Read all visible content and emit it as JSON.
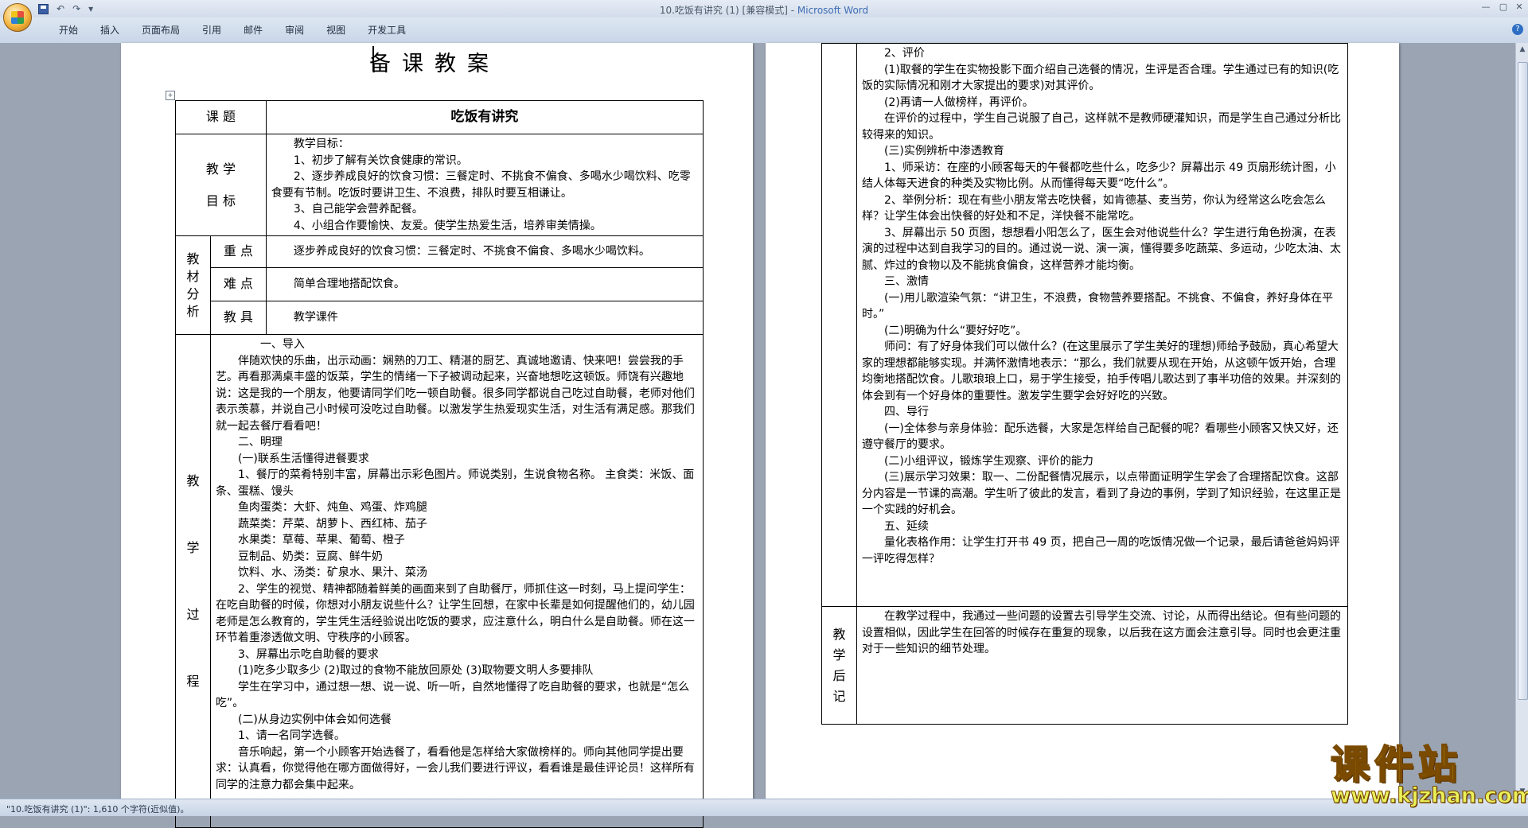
{
  "window": {
    "title": "10.吃饭有讲究 (1) [兼容模式] - ",
    "app_name": "Microsoft Word",
    "controls": [
      "—",
      "▢",
      "✕"
    ]
  },
  "quick_access": {
    "undo": "↶",
    "redo": "↷",
    "more": "▾"
  },
  "ribbon": {
    "tabs": [
      "开始",
      "插入",
      "页面布局",
      "引用",
      "邮件",
      "审阅",
      "视图",
      "开发工具"
    ],
    "help": "?"
  },
  "status_bar": {
    "text": "\"10.吃饭有讲究 (1)\": 1,610 个字符(近似值)。"
  },
  "doc": {
    "heading": "备课教案",
    "lesson_label": "课    题",
    "lesson_title": "吃饭有讲究",
    "goals_label_1": "教    学",
    "goals_label_2": "目    标",
    "goals": [
      "教学目标：",
      "1、初步了解有关饮食健康的常识。",
      "2、逐步养成良好的饮食习惯：三餐定时、不挑食不偏食、多喝水少喝饮料、吃零食要有节制。吃饭时要讲卫生、不浪费，排队时要互相谦让。",
      "3、自己能学会营养配餐。",
      "4、小组合作要愉快、友爱。使学生热爱生活，培养审美情操。"
    ],
    "analysis_label": [
      "教",
      "材",
      "分",
      "析"
    ],
    "key_label": "重  点",
    "key_text": "逐步养成良好的饮食习惯：三餐定时、不挑食不偏食、多喝水少喝饮料。",
    "difficulty_label": "难  点",
    "difficulty_text": "简单合理地搭配饮食。",
    "tools_label": "教  具",
    "tools_text": "教学课件",
    "process_label": [
      "教",
      "学",
      "过",
      "程"
    ],
    "process_p1": [
      {
        "t": "一、导入",
        "cls": "h2"
      },
      {
        "t": "伴随欢快的乐曲，出示动画：娴熟的刀工、精湛的厨艺、真诚地邀请、快来吧！尝尝我的手艺。再看那满桌丰盛的饭菜，学生的情绪一下子被调动起来，兴奋地想吃这顿饭。师饶有兴趣地说：这是我的一个朋友，他要请同学们吃一顿自助餐。很多同学都说自己吃过自助餐，老师对他们表示羡慕，并说自己小时候可没吃过自助餐。以激发学生热爱现实生活，对生活有满足感。那我们就一起去餐厅看看吧！",
        "cls": "ind"
      },
      {
        "t": "二、明理",
        "cls": "ind"
      },
      {
        "t": "(一)联系生活懂得进餐要求",
        "cls": "ind"
      },
      {
        "t": "1、餐厅的菜肴特别丰富，屏幕出示彩色图片。师说类别，生说食物名称。 主食类：米饭、面条、蛋糕、馒头",
        "cls": "ind"
      },
      {
        "t": "鱼肉蛋类：大虾、炖鱼、鸡蛋、炸鸡腿",
        "cls": "ind"
      },
      {
        "t": "蔬菜类：芹菜、胡萝卜、西红柿、茄子",
        "cls": "ind"
      },
      {
        "t": "水果类：草莓、苹果、葡萄、橙子",
        "cls": "ind"
      },
      {
        "t": "豆制品、奶类：豆腐、鲜牛奶",
        "cls": "ind"
      },
      {
        "t": "饮料、水、汤类：矿泉水、果汁、菜汤",
        "cls": "ind"
      },
      {
        "t": "2、学生的视觉、精神都随着鲜美的画面来到了自助餐厅，师抓住这一时刻，马上提问学生：在吃自助餐的时候，你想对小朋友说些什么？让学生回想，在家中长辈是如何提醒他们的，幼儿园老师是怎么教育的，学生凭生活经验说出吃饭的要求，应注意什么，明白什么是自助餐。师在这一环节着重渗透做文明、守秩序的小顾客。",
        "cls": "ind"
      },
      {
        "t": "3、屏幕出示吃自助餐的要求",
        "cls": "ind"
      },
      {
        "t": "(1)吃多少取多少 (2)取过的食物不能放回原处 (3)取物要文明人多要排队",
        "cls": "ind"
      },
      {
        "t": "学生在学习中，通过想一想、说一说、听一听，自然地懂得了吃自助餐的要求，也就是“怎么吃”。",
        "cls": "ind"
      },
      {
        "t": "(二)从身边实例中体会如何选餐",
        "cls": "ind"
      },
      {
        "t": "1、请一名同学选餐。",
        "cls": "ind"
      },
      {
        "t": "音乐响起，第一个小顾客开始选餐了，看看他是怎样给大家做榜样的。师向其他同学提出要求：认真看，你觉得他在哪方面做得好，一会儿我们要进行评议，看看谁是最佳评论员！这样所有同学的注意力都会集中起来。",
        "cls": "ind"
      }
    ],
    "process_p2": [
      "2、评价",
      "(1)取餐的学生在实物投影下面介绍自己选餐的情况，生评是否合理。学生通过已有的知识(吃饭的实际情况和刚才大家提出的要求)对其评价。",
      "(2)再请一人做榜样，再评价。",
      "在评价的过程中，学生自己说服了自己，这样就不是教师硬灌知识，而是学生自己通过分析比较得来的知识。",
      "(三)实例辨析中渗透教育",
      "1、师采访：在座的小顾客每天的午餐都吃些什么，吃多少？屏幕出示 49 页扇形统计图，小结人体每天进食的种类及实物比例。从而懂得每天要“吃什么”。",
      "2、举例分析：现在有些小朋友常去吃快餐，如肯德基、麦当劳，你认为经常这么吃会怎么样？让学生体会出快餐的好处和不足，洋快餐不能常吃。",
      "3、屏幕出示 50 页图，想想看小阳怎么了，医生会对他说些什么？学生进行角色扮演，在表演的过程中达到自我学习的目的。通过说一说、演一演，懂得要多吃蔬菜、多运动，少吃太油、太腻、炸过的食物以及不能挑食偏食，这样营养才能均衡。",
      "三、激情",
      "(一)用儿歌渲染气氛：“讲卫生，不浪费，食物营养要搭配。不挑食、不偏食，养好身体在平时。”",
      "(二)明确为什么“要好好吃”。",
      "师问：有了好身体我们可以做什么？(在这里展示了学生美好的理想)师给予鼓励，真心希望大家的理想都能够实现。并满怀激情地表示：“那么，我们就要从现在开始，从这顿午饭开始，合理均衡地搭配饮食。儿歌琅琅上口，易于学生接受，拍手传唱儿歌达到了事半功倍的效果。并深刻的体会到有一个好身体的重要性。激发学生要学会好好吃的兴致。",
      "四、导行",
      "(一)全体参与亲身体验：配乐选餐，大家是怎样给自己配餐的呢？看哪些小顾客又快又好，还遵守餐厅的要求。",
      "(二)小组评议，锻炼学生观察、评价的能力",
      "(三)展示学习效果：取一、二份配餐情况展示，以点带面证明学生学会了合理搭配饮食。这部分内容是一节课的高潮。学生听了彼此的发言，看到了身边的事例，学到了知识经验，在这里正是一个实践的好机会。",
      "五、延续",
      "量化表格作用：让学生打开书 49 页，把自己一周的吃饭情况做一个记录，最后请爸爸妈妈评一评吃得怎样？"
    ],
    "reflection_label": [
      "教",
      "学",
      "后",
      "记"
    ],
    "reflection_text": "在教学过程中，我通过一些问题的设置去引导学生交流、讨论，从而得出结论。但有些问题的设置相似，因此学生在回答的时候存在重复的现象，以后我在这方面会注意引导。同时也会更注重对于一些知识的细节处理。"
  },
  "watermark": {
    "line1": "课件站",
    "line2": "www.kjzhan.com"
  }
}
